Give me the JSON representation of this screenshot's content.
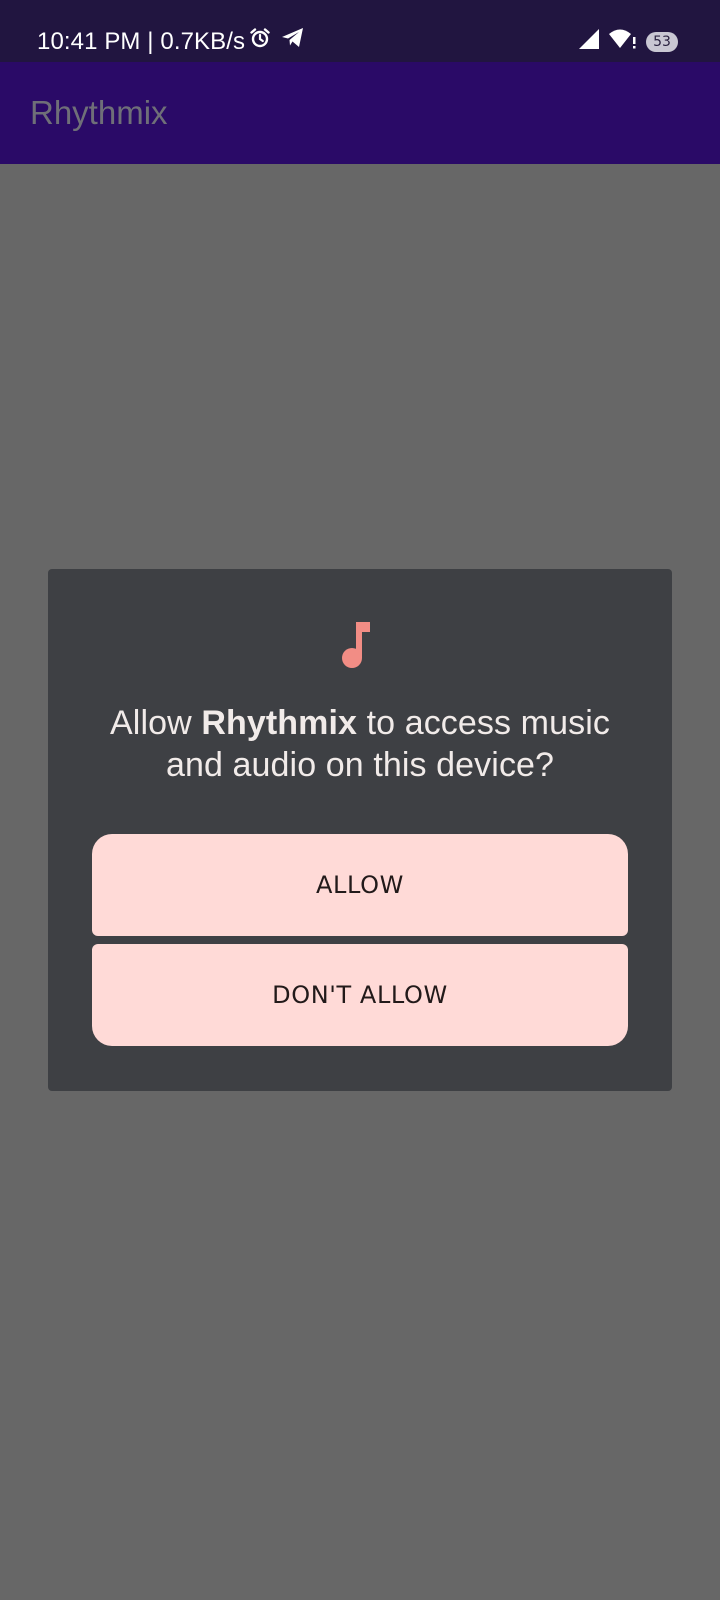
{
  "status_bar": {
    "time_speed": "10:41 PM | 0.7KB/s",
    "alarm_icon": "alarm-clock-icon",
    "telegram_icon": "telegram-icon",
    "signal_icon": "signal-icon",
    "wifi_icon": "wifi-icon",
    "battery_level": "53"
  },
  "app_bar": {
    "title": "Rhythmix"
  },
  "dialog": {
    "icon": "music-note-icon",
    "message_prefix": "Allow ",
    "app_name": "Rhythmix",
    "message_suffix": " to access music and audio on this device?",
    "allow_label": "ALLOW",
    "deny_label": "DON'T ALLOW"
  },
  "colors": {
    "status_bar": "#211540",
    "app_bar": "#2a0a67",
    "scrim": "#676767",
    "dialog_bg": "#3e4044",
    "button_bg": "#ffdad7",
    "icon_accent": "#f28d85"
  }
}
